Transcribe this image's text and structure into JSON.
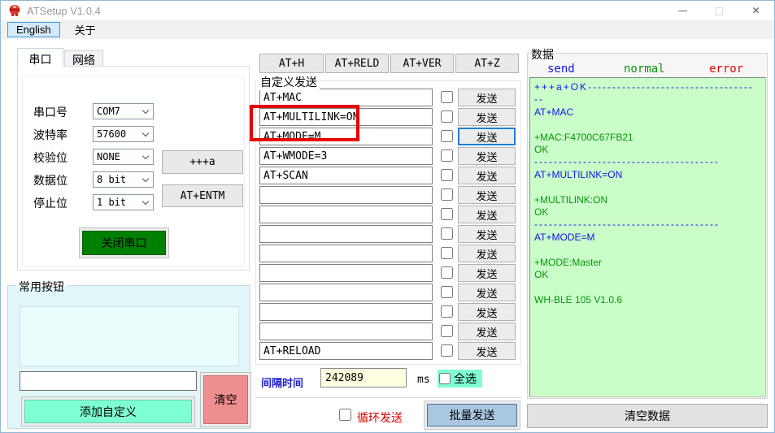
{
  "window": {
    "title": "ATSetup V1.0.4",
    "minimize_icon": "—",
    "maximize_icon": "□",
    "close_icon": "✕"
  },
  "menu": {
    "english_label": "English",
    "about_label": "关于"
  },
  "serial_panel": {
    "tab_serial": "串口",
    "tab_network": "网络",
    "fields": [
      {
        "label": "串口号",
        "value": "COM7"
      },
      {
        "label": "波特率",
        "value": "57600"
      },
      {
        "label": "校验位",
        "value": "NONE"
      },
      {
        "label": "数据位",
        "value": "8 bit"
      },
      {
        "label": "停止位",
        "value": "1 bit"
      }
    ],
    "plus_a_button": "+++a",
    "entm_button": "AT+ENTM",
    "close_serial_button": "关闭串口"
  },
  "common_buttons": {
    "title": "常用按钮",
    "input_value": "",
    "add_button": "添加自定义",
    "clear_button": "清空"
  },
  "custom_send": {
    "title": "自定义发送",
    "quick_buttons": [
      "AT+H",
      "AT+RELD",
      "AT+VER",
      "AT+Z"
    ],
    "send_label": "发送",
    "focused_row_index": 2,
    "rows": [
      "AT+MAC",
      "AT+MULTILINK=ON",
      "AT+MODE=M",
      "AT+WMODE=3",
      "AT+SCAN",
      "",
      "",
      "",
      "",
      "",
      "",
      "",
      "",
      "AT+RELOAD"
    ],
    "interval_label": "间隔时间",
    "interval_value": "242089",
    "interval_unit": "ms",
    "select_all_label": "全选",
    "loop_send_label": "循环发送",
    "batch_send_label": "批量发送"
  },
  "data_panel": {
    "title": "数据",
    "legend": [
      {
        "label": "send",
        "color": "#1414e6"
      },
      {
        "label": "normal",
        "color": "#089608"
      },
      {
        "label": "error",
        "color": "#e60000"
      }
    ],
    "terminal_lines": [
      {
        "text": "+++a+OK----------------------------------",
        "type": "send",
        "dash": true
      },
      {
        "text": "--",
        "type": "send",
        "dash": true
      },
      {
        "text": "AT+MAC",
        "type": "send"
      },
      {
        "text": "",
        "type": "normal"
      },
      {
        "text": "+MAC:F4700C67FB21",
        "type": "normal"
      },
      {
        "text": "OK",
        "type": "normal"
      },
      {
        "text": "--------------------------------------",
        "type": "send",
        "dash": true
      },
      {
        "text": "AT+MULTILINK=ON",
        "type": "send"
      },
      {
        "text": "",
        "type": "normal"
      },
      {
        "text": "+MULTILINK:ON",
        "type": "normal"
      },
      {
        "text": "OK",
        "type": "normal"
      },
      {
        "text": "--------------------------------------",
        "type": "send",
        "dash": true
      },
      {
        "text": "AT+MODE=M",
        "type": "send"
      },
      {
        "text": "",
        "type": "normal"
      },
      {
        "text": "+MODE:Master",
        "type": "normal"
      },
      {
        "text": "OK",
        "type": "normal"
      },
      {
        "text": "",
        "type": "normal"
      },
      {
        "text": "WH-BLE 105 V1.0.6",
        "type": "normal"
      }
    ],
    "clear_button": "清空数据"
  },
  "annotation": {
    "type": "highlight-box",
    "color": "#e60000"
  },
  "colors": {
    "terminal_bg": "#c9fec9",
    "close_serial_green": "#008000",
    "add_custom_mint": "#7fffd4",
    "clear_salmon": "#ef8e8e",
    "batch_blue": "#a9c7e1",
    "select_all_mint": "#7fffd4",
    "interval_bg": "#ffffe1",
    "annotation_red": "#e60000"
  }
}
